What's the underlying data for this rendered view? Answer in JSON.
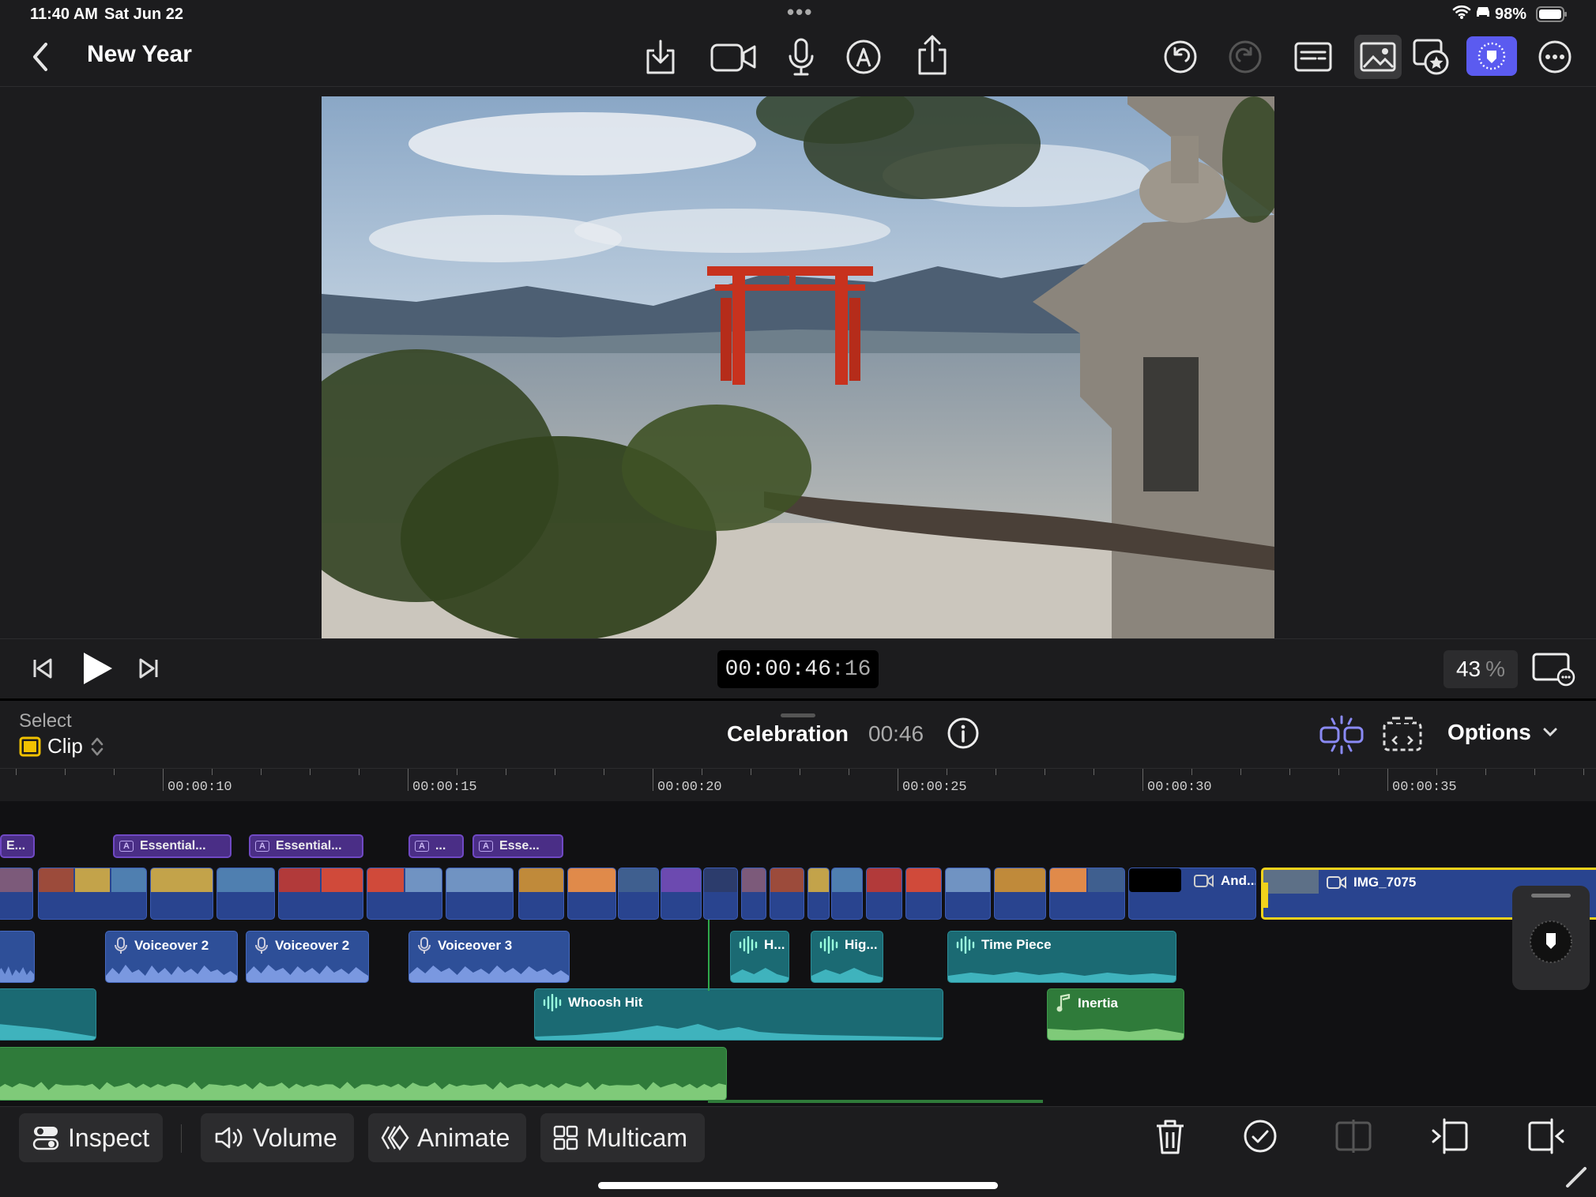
{
  "status_bar": {
    "time": "11:40 AM",
    "date": "Sat Jun 22",
    "battery": "98%"
  },
  "project": {
    "title": "New Year"
  },
  "toolbar": {
    "icons": [
      "import-icon",
      "camera-icon",
      "microphone-icon",
      "pen-icon",
      "share-icon",
      "undo-icon",
      "redo-icon",
      "captions-icon",
      "photos-icon",
      "favorites-icon",
      "inspector-toggle-icon",
      "more-icon"
    ]
  },
  "viewer": {
    "image": "Torii gate in sea with pine branches and stone lantern"
  },
  "transport": {
    "timecode_main": "00:00:46",
    "timecode_frames": ":16",
    "zoom_value": "43",
    "zoom_unit": "%"
  },
  "timeline": {
    "select_label": "Select",
    "mode_label": "Clip",
    "project_name": "Celebration",
    "duration": "00:46",
    "options_label": "Options",
    "ruler": [
      "00:00:10",
      "00:00:15",
      "00:00:20",
      "00:00:25",
      "00:00:30",
      "00:00:35"
    ],
    "titles": [
      "E...",
      "Essential...",
      "Essential...",
      "...",
      "Esse..."
    ],
    "video_clips": {
      "and_label": "And...",
      "img_label": "IMG_7075"
    },
    "audio": {
      "vo2a": "Voiceover 2",
      "vo2b": "Voiceover 2",
      "vo3": "Voiceover 3",
      "h": "H...",
      "hig": "Hig...",
      "timepiece": "Time Piece",
      "whoosh": "Whoosh Hit",
      "inertia": "Inertia"
    }
  },
  "bottom_toolbar": {
    "inspect": "Inspect",
    "volume": "Volume",
    "animate": "Animate",
    "multicam": "Multicam"
  },
  "colors": {
    "accent": "#5b5bf0",
    "title_clip": "#4a2e86",
    "video_clip": "#29448f",
    "teal_audio": "#1b6a73",
    "green_audio": "#2f7b3a",
    "selection": "#f2d21b"
  }
}
